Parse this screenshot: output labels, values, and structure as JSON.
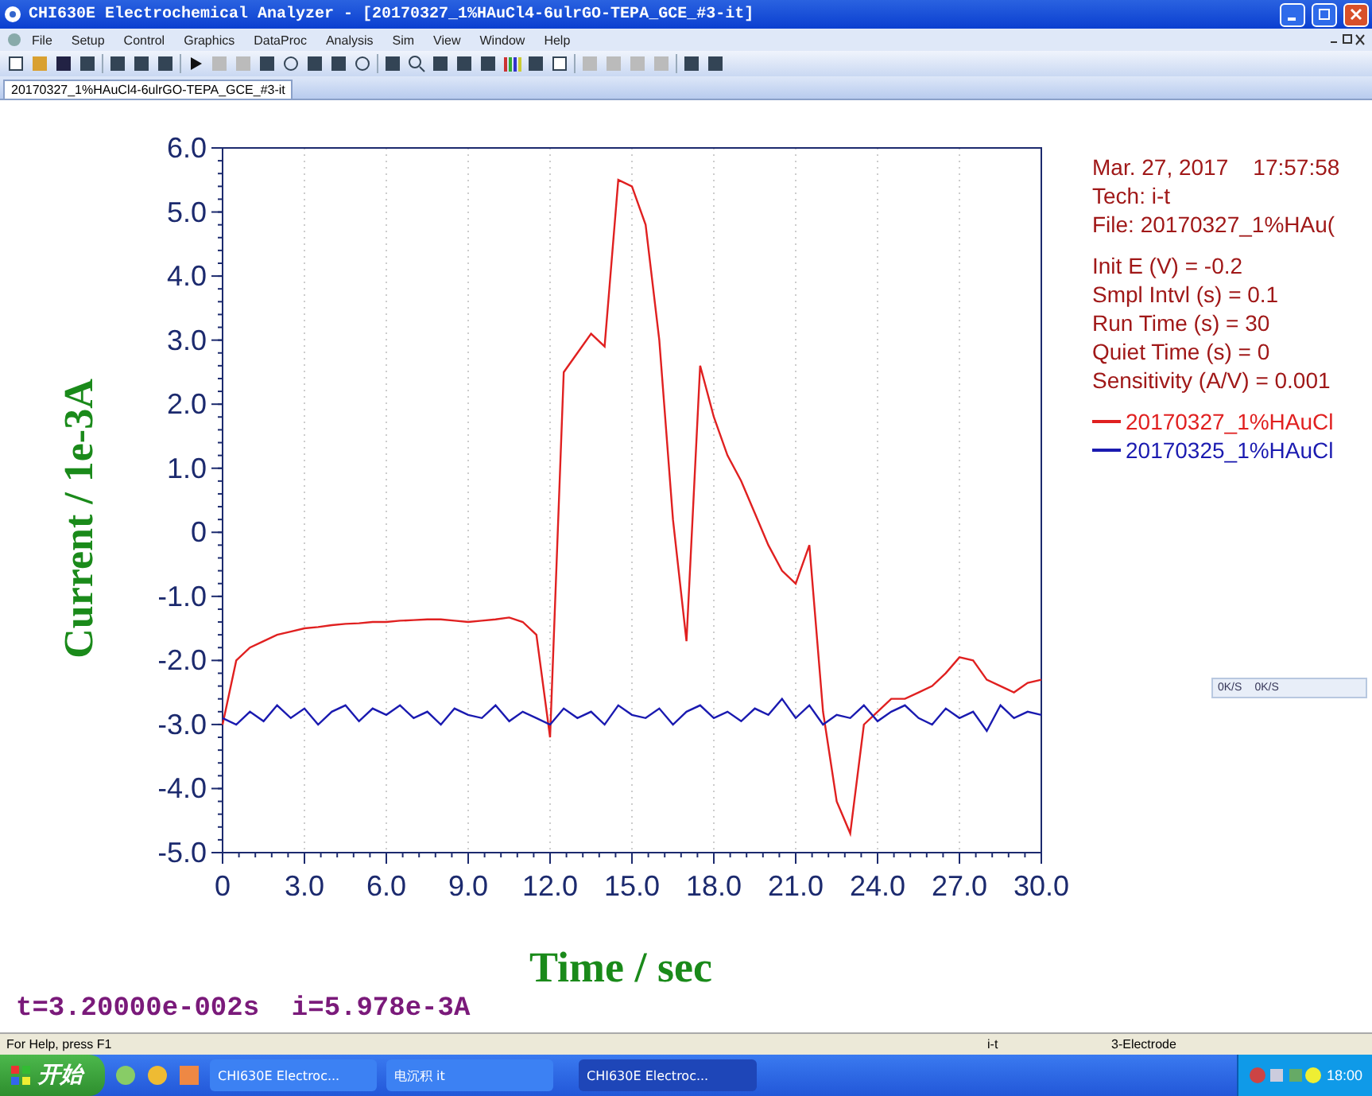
{
  "window": {
    "title": "CHI630E Electrochemical Analyzer - [20170327_1%HAuCl4-6ulrGO-TEPA_GCE_#3-it]"
  },
  "menu": [
    "File",
    "Setup",
    "Control",
    "Graphics",
    "DataProc",
    "Analysis",
    "Sim",
    "View",
    "Window",
    "Help"
  ],
  "document_tab": {
    "label": "20170327_1%HAuCl4-6ulrGO-TEPA_GCE_#3-it",
    "selected": true
  },
  "info": {
    "header": [
      "Mar. 27, 2017    17:57:58",
      "Tech: i-t",
      "File: 20170327_1%HAu("
    ],
    "params": [
      "Init E (V) = -0.2",
      "Smpl Intvl (s) = 0.1",
      "Run Time (s) = 30",
      "Quiet Time (s) = 0",
      "Sensitivity (A/V) = 0.001"
    ]
  },
  "chart_data": {
    "type": "line",
    "grid": true,
    "xlabel": "Time / sec",
    "ylabel": "Current / 1e-3A",
    "xlim": [
      0,
      30
    ],
    "ylim": [
      -5,
      6
    ],
    "xticks": [
      {
        "value": 0,
        "label": "0"
      },
      {
        "value": 3,
        "label": "3.0"
      },
      {
        "value": 6,
        "label": "6.0"
      },
      {
        "value": 9,
        "label": "9.0"
      },
      {
        "value": 12,
        "label": "12.0"
      },
      {
        "value": 15,
        "label": "15.0"
      },
      {
        "value": 18,
        "label": "18.0"
      },
      {
        "value": 21,
        "label": "21.0"
      },
      {
        "value": 24,
        "label": "24.0"
      },
      {
        "value": 27,
        "label": "27.0"
      },
      {
        "value": 30,
        "label": "30.0"
      }
    ],
    "yticks": [
      {
        "value": 6,
        "label": "6.0"
      },
      {
        "value": 5,
        "label": "5.0"
      },
      {
        "value": 4,
        "label": "4.0"
      },
      {
        "value": 3,
        "label": "3.0"
      },
      {
        "value": 2,
        "label": "2.0"
      },
      {
        "value": 1,
        "label": "1.0"
      },
      {
        "value": 0,
        "label": "0"
      },
      {
        "value": -1,
        "label": "-1.0"
      },
      {
        "value": -2,
        "label": "-2.0"
      },
      {
        "value": -3,
        "label": "-3.0"
      },
      {
        "value": -4,
        "label": "-4.0"
      },
      {
        "value": -5,
        "label": "-5.0"
      }
    ],
    "x": [
      0,
      0.5,
      1,
      1.5,
      2,
      2.5,
      3,
      3.5,
      4,
      4.5,
      5,
      5.5,
      6,
      6.5,
      7,
      7.5,
      8,
      8.5,
      9,
      9.5,
      10,
      10.5,
      11,
      11.5,
      12,
      12.5,
      13,
      13.5,
      14,
      14.5,
      15,
      15.5,
      16,
      16.5,
      17,
      17.5,
      18,
      18.5,
      19,
      19.5,
      20,
      20.5,
      21,
      21.5,
      22,
      22.5,
      23,
      23.5,
      24,
      24.5,
      25,
      25.5,
      26,
      26.5,
      27,
      27.5,
      28,
      28.5,
      29,
      29.5,
      30
    ],
    "series": [
      {
        "name": "20170327_1%HAuCl",
        "color": "#e02020",
        "values": [
          -3.0,
          -2.0,
          -1.8,
          -1.7,
          -1.6,
          -1.55,
          -1.5,
          -1.48,
          -1.45,
          -1.43,
          -1.42,
          -1.4,
          -1.4,
          -1.38,
          -1.37,
          -1.36,
          -1.36,
          -1.38,
          -1.4,
          -1.38,
          -1.36,
          -1.33,
          -1.4,
          -1.6,
          -3.2,
          2.5,
          2.8,
          3.1,
          2.9,
          5.5,
          5.4,
          4.8,
          3.0,
          0.2,
          -1.7,
          2.6,
          1.8,
          1.2,
          0.8,
          0.3,
          -0.2,
          -0.6,
          -0.8,
          -0.2,
          -2.8,
          -4.2,
          -4.7,
          -3.0,
          -2.8,
          -2.6,
          -2.6,
          -2.5,
          -2.4,
          -2.2,
          -1.95,
          -2.0,
          -2.3,
          -2.4,
          -2.5,
          -2.35,
          -2.3
        ]
      },
      {
        "name": "20170325_1%HAuCl",
        "color": "#1a1ab0",
        "values": [
          -2.9,
          -3.0,
          -2.8,
          -2.95,
          -2.7,
          -2.9,
          -2.75,
          -3.0,
          -2.8,
          -2.7,
          -2.95,
          -2.75,
          -2.85,
          -2.7,
          -2.9,
          -2.8,
          -3.0,
          -2.75,
          -2.85,
          -2.9,
          -2.7,
          -2.95,
          -2.8,
          -2.9,
          -3.0,
          -2.75,
          -2.9,
          -2.8,
          -3.0,
          -2.7,
          -2.85,
          -2.9,
          -2.75,
          -3.0,
          -2.8,
          -2.7,
          -2.9,
          -2.8,
          -2.95,
          -2.75,
          -2.85,
          -2.6,
          -2.9,
          -2.7,
          -3.0,
          -2.85,
          -2.9,
          -2.7,
          -2.95,
          -2.8,
          -2.7,
          -2.9,
          -3.0,
          -2.75,
          -2.9,
          -2.8,
          -3.1,
          -2.7,
          -2.9,
          -2.8,
          -2.85
        ]
      }
    ]
  },
  "readout": "t=3.20000e-002s  i=5.978e-3A",
  "float_bar": [
    "0K/S",
    "0K/S"
  ],
  "status_bar": [
    "For Help, press F1",
    "i-t",
    "3-Electrode"
  ],
  "taskbar": {
    "start": "开始",
    "tasks": [
      {
        "label": "CHI630E Electroc...",
        "selected": false
      },
      {
        "label": "电沉积 it",
        "selected": false
      },
      {
        "label": "CHI630E Electroc...",
        "selected": true
      }
    ],
    "clock": "18:00"
  }
}
